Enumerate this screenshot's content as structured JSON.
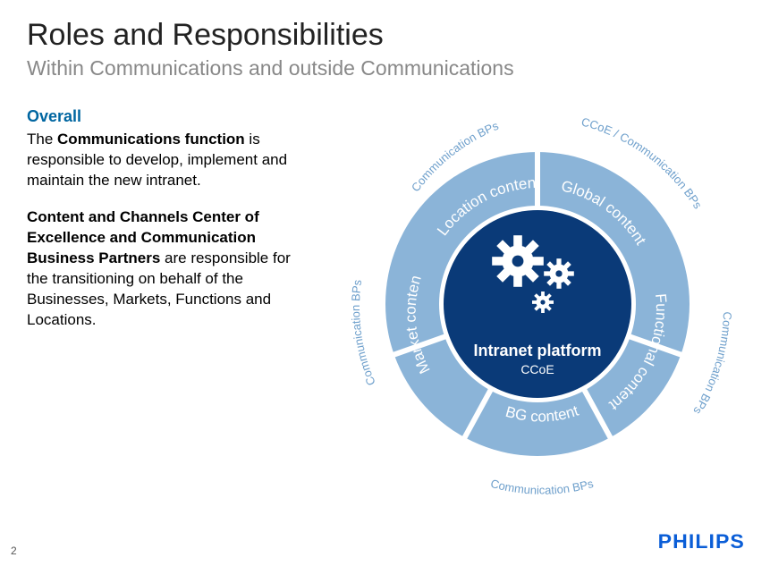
{
  "header": {
    "title": "Roles and Responsibilities",
    "subtitle": "Within Communications and outside Communications"
  },
  "body": {
    "section_heading": "Overall",
    "para1_lead": "Communications function",
    "para1_pre": "The ",
    "para1_post": " is responsible to develop, implement and maintain the new intranet.",
    "para2_lead": "Content and Channels Center of Excellence and Communication Business Partners",
    "para2_post": " are responsible for the transitioning on behalf of the Businesses, Markets, Functions and Locations."
  },
  "diagram": {
    "center_title": "Intranet platform",
    "center_sub": "CCoE",
    "segments": {
      "top_left": "Location content",
      "top_right": "Global content",
      "right": "Functional content",
      "bottom": "BG content",
      "left": "Market content"
    },
    "outer": {
      "top_left": "Communication BPs",
      "top_right": "CCoE / Communication BPs",
      "right": "Communication BPs",
      "bottom": "Communication BPs",
      "left": "Communication BPs"
    },
    "icon_name": "gears-icon"
  },
  "footer": {
    "page_number": "2",
    "brand": "PHILIPS"
  },
  "colors": {
    "ring_fill": "#8bb4d8",
    "center_fill": "#0a3a78",
    "heading_accent": "#0066a1",
    "brand": "#0b5ed7"
  }
}
